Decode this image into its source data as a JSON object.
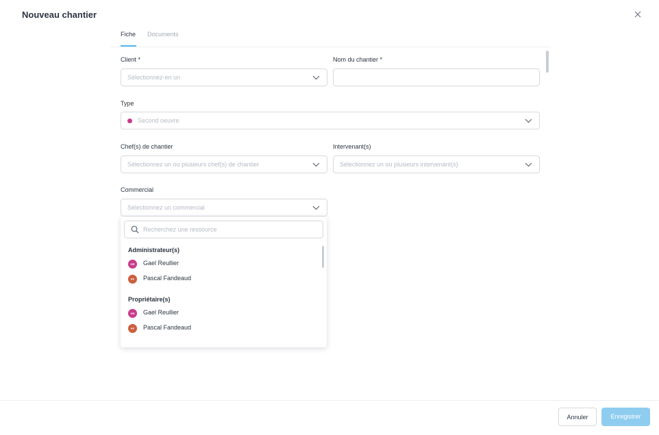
{
  "dialog": {
    "title": "Nouveau chantier"
  },
  "tabs": [
    {
      "label": "Fiche"
    },
    {
      "label": "Documents"
    }
  ],
  "form": {
    "client": {
      "label": "Client *",
      "placeholder": "Sélectionnez-en un"
    },
    "nom": {
      "label": "Nom du chantier *",
      "value": ""
    },
    "type": {
      "label": "Type",
      "value": "Second oeuvre",
      "dot_color": "#c83c8a"
    },
    "chefs": {
      "label": "Chef(s) de chantier",
      "placeholder": "Sélectionnez un ou plusieurs chef(s) de chantier"
    },
    "intervenants": {
      "label": "Intervenant(s)",
      "placeholder": "Sélectionnez un ou plusieurs intervenant(s)"
    },
    "commercial": {
      "label": "Commercial",
      "placeholder": "Sélectionnez un commercial"
    }
  },
  "dropdown": {
    "search_placeholder": "Recherchez une ressource",
    "groups": [
      {
        "name": "Administrateur(s)",
        "items": [
          {
            "initials": "GR",
            "name": "Gael Reullier",
            "color": "#c83c8a"
          },
          {
            "initials": "PF",
            "name": "Pascal Fandeaud",
            "color": "#cc5f3d"
          }
        ]
      },
      {
        "name": "Propriétaire(s)",
        "items": [
          {
            "initials": "GR",
            "name": "Gael Reullier",
            "color": "#c83c8a"
          },
          {
            "initials": "PF",
            "name": "Pascal Fandeaud",
            "color": "#cc5f3d"
          }
        ]
      }
    ]
  },
  "footer": {
    "cancel_label": "Annuler",
    "save_label": "Enregistrer"
  },
  "colors": {
    "accent": "#56b6e6",
    "save_disabled": "#8fcdf0"
  }
}
